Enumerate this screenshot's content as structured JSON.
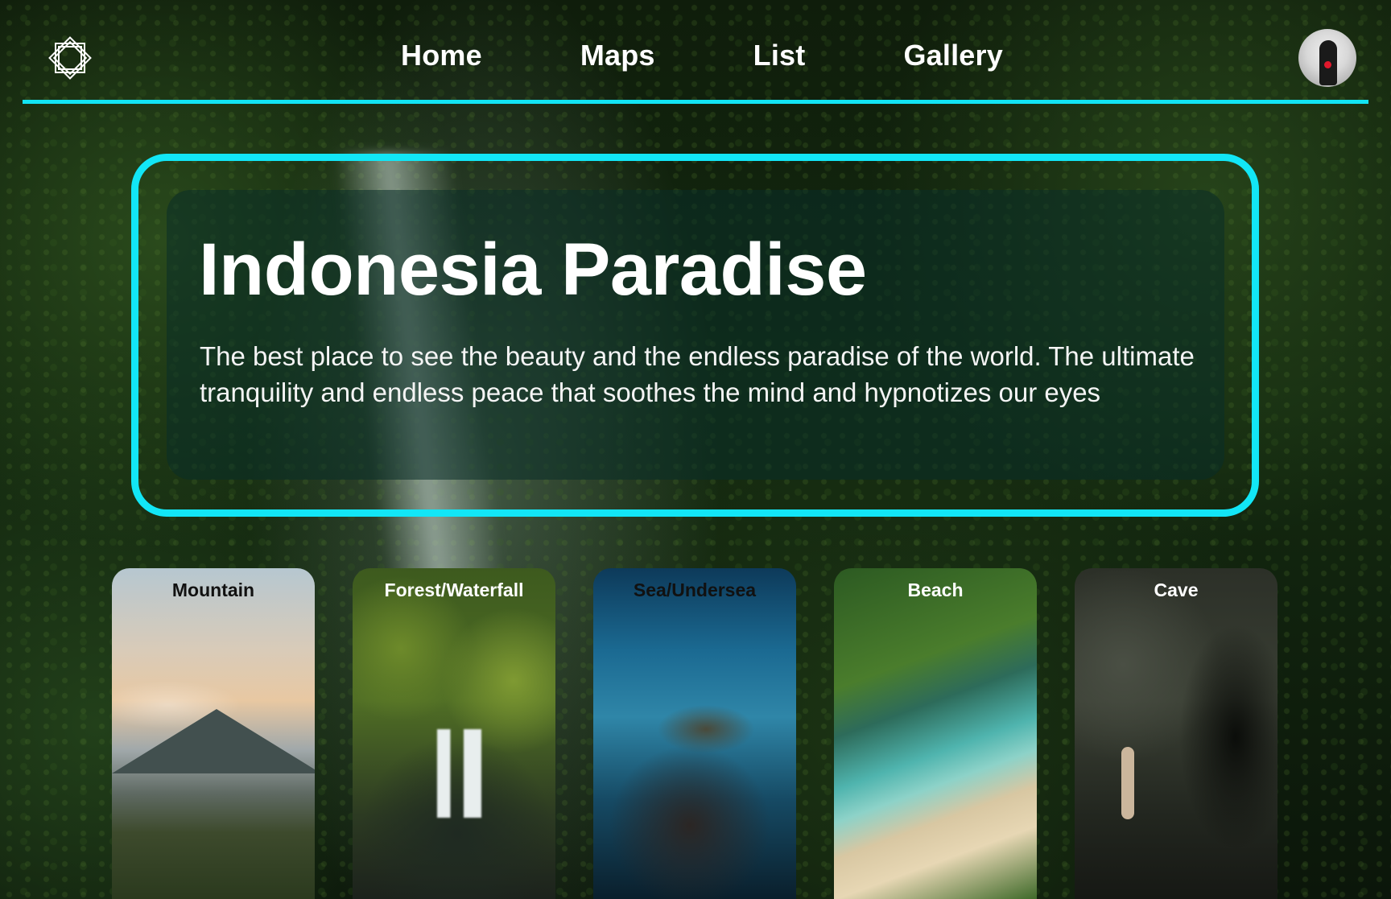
{
  "nav": {
    "links": [
      "Home",
      "Maps",
      "List",
      "Gallery"
    ],
    "logo_icon": "octagram-star-icon",
    "avatar_icon": "user-avatar",
    "accent_color": "#12e4f4"
  },
  "hero": {
    "title": "Indonesia Paradise",
    "description": "The best place to see the beauty and the endless paradise of the world. The ultimate tranquility and endless peace that soothes the mind and hypnotizes our eyes"
  },
  "categories": [
    {
      "label": "Mountain"
    },
    {
      "label": "Forest/Waterfall"
    },
    {
      "label": "Sea/Undersea"
    },
    {
      "label": "Beach"
    },
    {
      "label": "Cave"
    }
  ]
}
